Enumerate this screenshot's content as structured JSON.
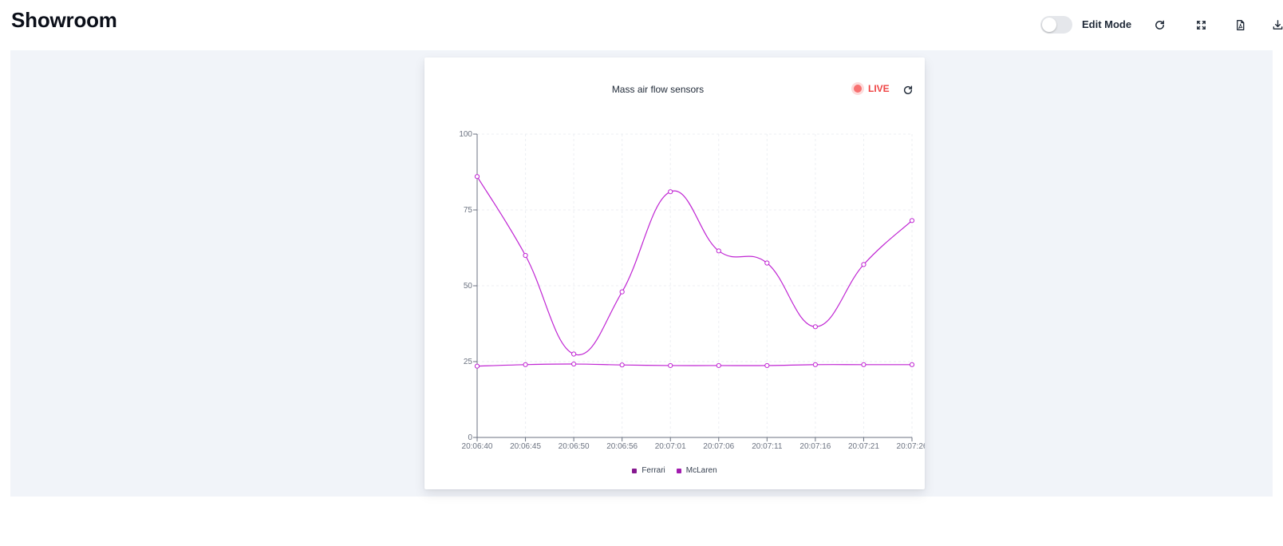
{
  "header": {
    "title": "Showroom",
    "edit_mode_label": "Edit Mode",
    "edit_mode_on": false
  },
  "toolbar": {
    "icons": [
      "refresh-icon",
      "fullscreen-icon",
      "pdf-icon",
      "download-icon"
    ]
  },
  "widget": {
    "title": "Mass air flow sensors",
    "live_label": "LIVE",
    "live_color": "#ef4444"
  },
  "chart_data": {
    "type": "line",
    "x": [
      "20:06:40",
      "20:06:45",
      "20:06:50",
      "20:06:56",
      "20:07:01",
      "20:07:06",
      "20:07:11",
      "20:07:16",
      "20:07:21",
      "20:07:26"
    ],
    "series": [
      {
        "name": "Ferrari",
        "color": "#86198f",
        "line_color": "#c026d3",
        "values": [
          86,
          60,
          27.5,
          48,
          81,
          61.5,
          57.5,
          36.5,
          57,
          71.5
        ]
      },
      {
        "name": "McLaren",
        "color": "#a21caf",
        "line_color": "#c026d3",
        "values": [
          23.5,
          24,
          24.2,
          23.9,
          23.7,
          23.7,
          23.7,
          24,
          24,
          24
        ]
      }
    ],
    "yticks": [
      "0",
      "25",
      "50",
      "75",
      "100"
    ],
    "ylim": [
      0,
      100
    ],
    "grid": true,
    "smooth": true,
    "legend_position": "bottom"
  }
}
